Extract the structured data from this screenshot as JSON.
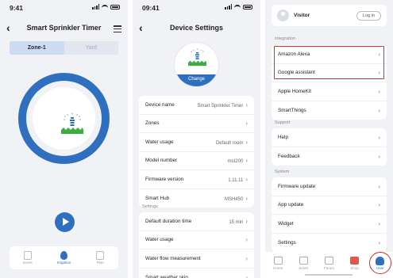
{
  "s1": {
    "time": "9:41",
    "title": "Smart Sprinkler Timer",
    "tabs": [
      "Zone-1",
      "Yard"
    ],
    "nav": [
      "Event",
      "Irrigation",
      "Plan"
    ]
  },
  "s2": {
    "time": "09:41",
    "title": "Device Settings",
    "change": "Change",
    "rows1": [
      {
        "label": "Device name",
        "value": "Smart Sprinkler Timer"
      },
      {
        "label": "Zones",
        "value": ""
      },
      {
        "label": "Water usage",
        "value": "Default room"
      },
      {
        "label": "Model number",
        "value": "mst200"
      },
      {
        "label": "Firmware version",
        "value": "1.11.11"
      },
      {
        "label": "Smart Hub",
        "value": "MSH450"
      }
    ],
    "settings_header": "Settings",
    "rows2": [
      {
        "label": "Default duration time",
        "value": "15 min"
      },
      {
        "label": "Water usage",
        "value": ""
      },
      {
        "label": "Water flow measurement",
        "value": ""
      },
      {
        "label": "Smart weather skip",
        "value": ""
      }
    ]
  },
  "s3": {
    "visitor": "Visitor",
    "login": "Log in",
    "integration_header": "Integration",
    "integration": [
      "Amazon Alexa",
      "Google assistant",
      "Apple HomeKit",
      "SmartThings"
    ],
    "support_header": "Support",
    "support": [
      "Help",
      "Feedback"
    ],
    "system_header": "System",
    "system": [
      "Firmware update",
      "App update",
      "Widget",
      "Settings"
    ],
    "tabbar": [
      "Home",
      "Smart",
      "Forum",
      "Shop",
      "User"
    ]
  },
  "colors": {
    "accent": "#2f6fc0",
    "highlight": "#d93030",
    "grass": "#3cae3f"
  }
}
